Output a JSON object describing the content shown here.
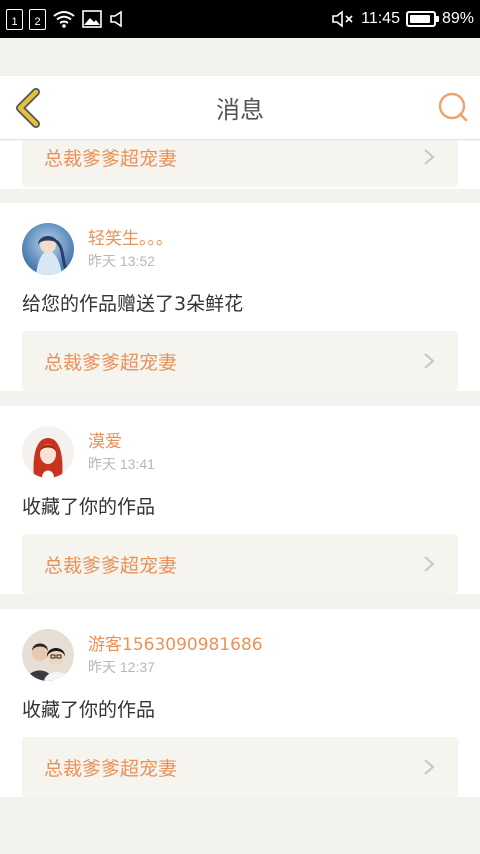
{
  "status_bar": {
    "sim1": "1",
    "sim2": "2",
    "time": "11:45",
    "battery": "89%",
    "battery_level": 0.89,
    "icons": [
      "sim-1-icon",
      "sim-2-icon",
      "wifi-icon",
      "image-icon",
      "volume-icon",
      "mute-icon",
      "battery-icon"
    ]
  },
  "header": {
    "title": "消息",
    "back_icon": "chevron-left-icon",
    "search_icon": "search-icon"
  },
  "messages": [
    {
      "partial": true,
      "work_title": "总裁爹爹超宠妻"
    },
    {
      "username": "轻笑生。。。",
      "time": "昨天 13:52",
      "message": "给您的作品赠送了3朵鲜花",
      "work_title": "总裁爹爹超宠妻"
    },
    {
      "username": "漠爱",
      "time": "昨天 13:41",
      "message": "收藏了你的作品",
      "work_title": "总裁爹爹超宠妻"
    },
    {
      "username": "游客1563090981686",
      "time": "昨天 12:37",
      "message": "收藏了你的作品",
      "work_title": "总裁爹爹超宠妻"
    }
  ],
  "colors": {
    "accent": "#e8925a",
    "back_icon": "#e3c13b",
    "card_box": "#f5f4ee",
    "background": "#f3f2ef"
  }
}
